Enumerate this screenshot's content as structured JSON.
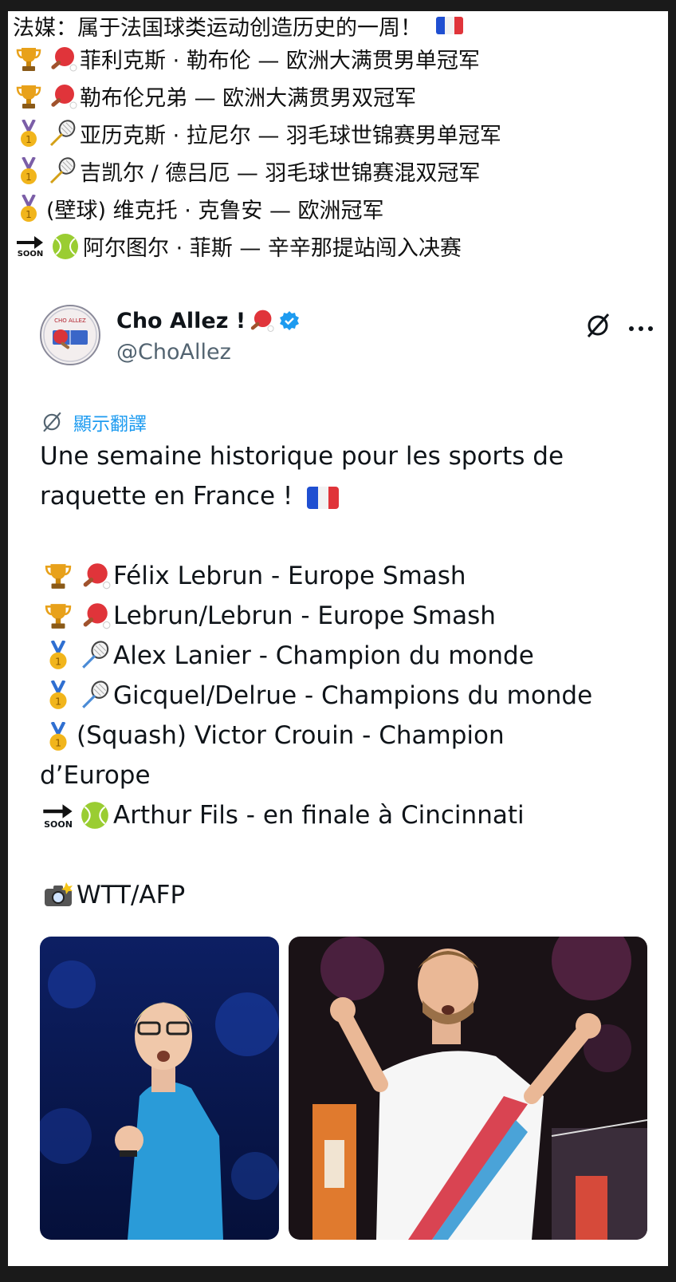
{
  "zh_post": {
    "title": "法媒：属于法国球类运动创造历史的一周！",
    "lines": [
      {
        "icons": [
          "trophy-icon",
          "ping-pong-icon"
        ],
        "text": "菲利克斯 · 勒布伦 — 欧洲大满贯男单冠军"
      },
      {
        "icons": [
          "trophy-icon",
          "ping-pong-icon"
        ],
        "text": "勒布伦兄弟 — 欧洲大满贯男双冠军"
      },
      {
        "icons": [
          "gold-medal-icon",
          "badminton-icon"
        ],
        "text": "亚历克斯 · 拉尼尔 — 羽毛球世锦赛男单冠军"
      },
      {
        "icons": [
          "gold-medal-icon",
          "badminton-icon"
        ],
        "text": "吉凯尔 / 德吕厄 — 羽毛球世锦赛混双冠军"
      },
      {
        "icons": [
          "gold-medal-icon"
        ],
        "text": "(壁球) 维克托 · 克鲁安 — 欧洲冠军"
      },
      {
        "icons": [
          "soon-arrow-icon",
          "tennis-ball-icon"
        ],
        "text": "阿尔图尔 · 菲斯 — 辛辛那提站闯入决赛"
      }
    ],
    "soon_label": "SOON"
  },
  "tweet": {
    "display_name": "Cho Allez !",
    "handle": "@ChoAllez",
    "translate_label": "顯示翻譯",
    "intro": "Une semaine historique pour les sports de raquette en France !",
    "lines": [
      "Félix Lebrun - Europe Smash",
      "Lebrun/Lebrun - Europe Smash",
      "Alex Lanier - Champion du monde",
      "Gicquel/Delrue - Champions du monde",
      "(Squash) Victor Crouin - Champion d’Europe",
      "Arthur Fils - en finale à Cincinnati"
    ],
    "soon_label": "SOON",
    "credit": "WTT/AFP"
  },
  "colors": {
    "accent_blue": "#1d9bf0",
    "flag_blue": "#1f4fd1",
    "flag_red": "#e0343a",
    "text_gray": "#536471"
  }
}
